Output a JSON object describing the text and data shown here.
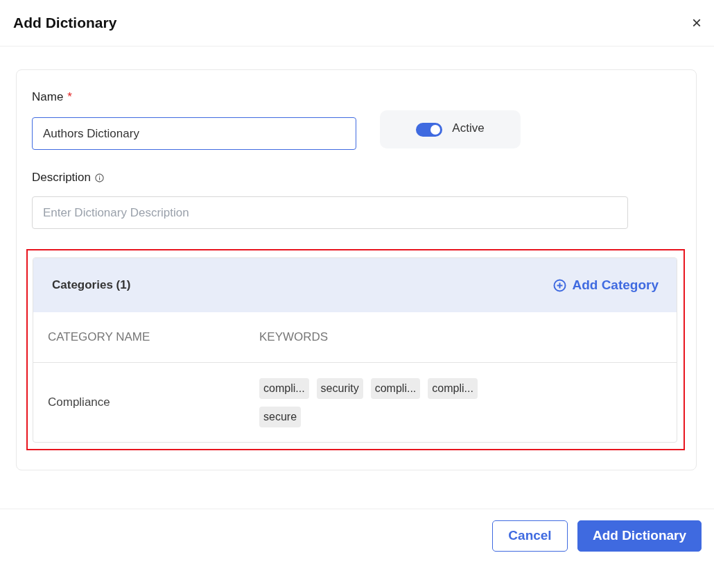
{
  "dialog": {
    "title": "Add Dictionary",
    "close": "×"
  },
  "name_field": {
    "label": "Name",
    "required_mark": "*",
    "value": "Authors Dictionary",
    "focused": true
  },
  "status_toggle": {
    "label": "Active",
    "on": true
  },
  "description_field": {
    "label": "Description",
    "placeholder": "Enter Dictionary Description"
  },
  "categories": {
    "highlighted": true,
    "title": "Categories (1)",
    "add_label": "Add Category",
    "columns": [
      "CATEGORY NAME",
      "KEYWORDS"
    ],
    "rows": [
      {
        "name": "Compliance",
        "keywords": [
          "compli...",
          "security",
          "compli...",
          "compli...",
          "secure"
        ]
      }
    ]
  },
  "buttons": [
    {
      "label": "Cancel",
      "kind": "secondary"
    },
    {
      "label": "Add Dictionary",
      "kind": "primary"
    }
  ]
}
